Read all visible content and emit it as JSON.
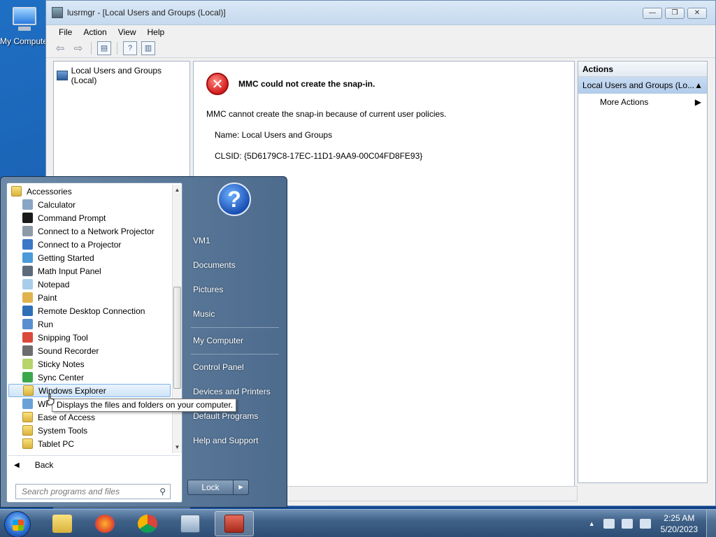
{
  "desktop": {
    "icon_label": "My Computer"
  },
  "window": {
    "title": "lusrmgr - [Local Users and Groups (Local)]",
    "controls": {
      "minimize": "—",
      "restore": "❐",
      "close": "✕"
    },
    "menu": [
      "File",
      "Action",
      "View",
      "Help"
    ],
    "tree_root": "Local Users and Groups (Local)",
    "error": {
      "title": "MMC could not create the snap-in.",
      "message": "MMC cannot create the snap-in because of current user policies.",
      "name_line": "Name: Local Users and Groups",
      "clsid_line": "CLSID: {5D6179C8-17EC-11D1-9AA9-00C04FD8FE93}"
    },
    "actions": {
      "header": "Actions",
      "selected": "Local Users and Groups (Lo...",
      "more": "More Actions"
    }
  },
  "start_menu": {
    "programs": [
      {
        "label": "Accessories",
        "type": "folder",
        "top": true
      },
      {
        "label": "Calculator",
        "color": "#8aa6c6"
      },
      {
        "label": "Command Prompt",
        "color": "#1a1a1a"
      },
      {
        "label": "Connect to a Network Projector",
        "color": "#8d9aa8"
      },
      {
        "label": "Connect to a Projector",
        "color": "#3a79c6"
      },
      {
        "label": "Getting Started",
        "color": "#4b9bd8"
      },
      {
        "label": "Math Input Panel",
        "color": "#5b6b7b"
      },
      {
        "label": "Notepad",
        "color": "#a9cde9"
      },
      {
        "label": "Paint",
        "color": "#e0b34c"
      },
      {
        "label": "Remote Desktop Connection",
        "color": "#2f6fb8"
      },
      {
        "label": "Run",
        "color": "#5a8fcf"
      },
      {
        "label": "Snipping Tool",
        "color": "#d94a3a"
      },
      {
        "label": "Sound Recorder",
        "color": "#6d6d6d"
      },
      {
        "label": "Sticky Notes",
        "color": "#b6d46a"
      },
      {
        "label": "Sync Center",
        "color": "#3aa84a"
      },
      {
        "label": "Windows Explorer",
        "type": "folder",
        "highlight": true
      },
      {
        "label": "Wi",
        "color": "#6aa2d8"
      },
      {
        "label": "Ease of Access",
        "type": "folder"
      },
      {
        "label": "System Tools",
        "type": "folder"
      },
      {
        "label": "Tablet PC",
        "type": "folder"
      }
    ],
    "back": "Back",
    "search_placeholder": "Search programs and files",
    "right_items": [
      "VM1",
      "Documents",
      "Pictures",
      "Music",
      "My Computer",
      "Control Panel",
      "Devices and Printers",
      "Default Programs",
      "Help and Support"
    ],
    "lock": "Lock",
    "tooltip": "Displays the files and folders on your computer."
  },
  "taskbar": {
    "apps": [
      "Windows Explorer",
      "Firefox",
      "Chrome",
      "Server Manager",
      "Toolbox"
    ],
    "time": "2:25 AM",
    "date": "5/20/2023"
  }
}
